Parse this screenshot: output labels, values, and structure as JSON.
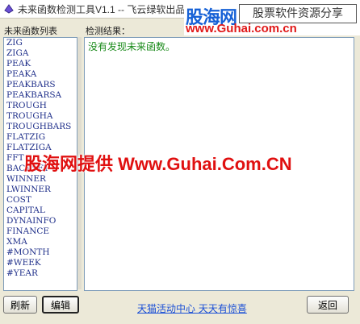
{
  "window": {
    "title": "未来函数检测工具V1.1 -- 飞云绿软出品"
  },
  "watermark": {
    "logo": "股海网",
    "slogan": "股票软件资源分享",
    "url_top": "www.Guhai.com.cn",
    "center": "股海网提供 Www.Guhai.Com.CN"
  },
  "left_panel": {
    "label": "未来函数列表",
    "items": [
      "ZIG",
      "ZIGA",
      "PEAK",
      "PEAKA",
      "PEAKBARS",
      "PEAKBARSA",
      "TROUGH",
      "TROUGHA",
      "TROUGHBARS",
      "FLATZIG",
      "FLATZIGA",
      "FFT",
      "BACKSET",
      "WINNER",
      "LWINNER",
      "COST",
      "CAPITAL",
      "DYNAINFO",
      "FINANCE",
      "XMA",
      "#MONTH",
      "#WEEK",
      "#YEAR"
    ]
  },
  "right_panel": {
    "label": "检测结果：",
    "result": "没有发现未来函数。"
  },
  "buttons": {
    "refresh": "刷新",
    "edit": "编辑",
    "back": "返回"
  },
  "ad_link": "天猫活动中心 天天有惊喜"
}
